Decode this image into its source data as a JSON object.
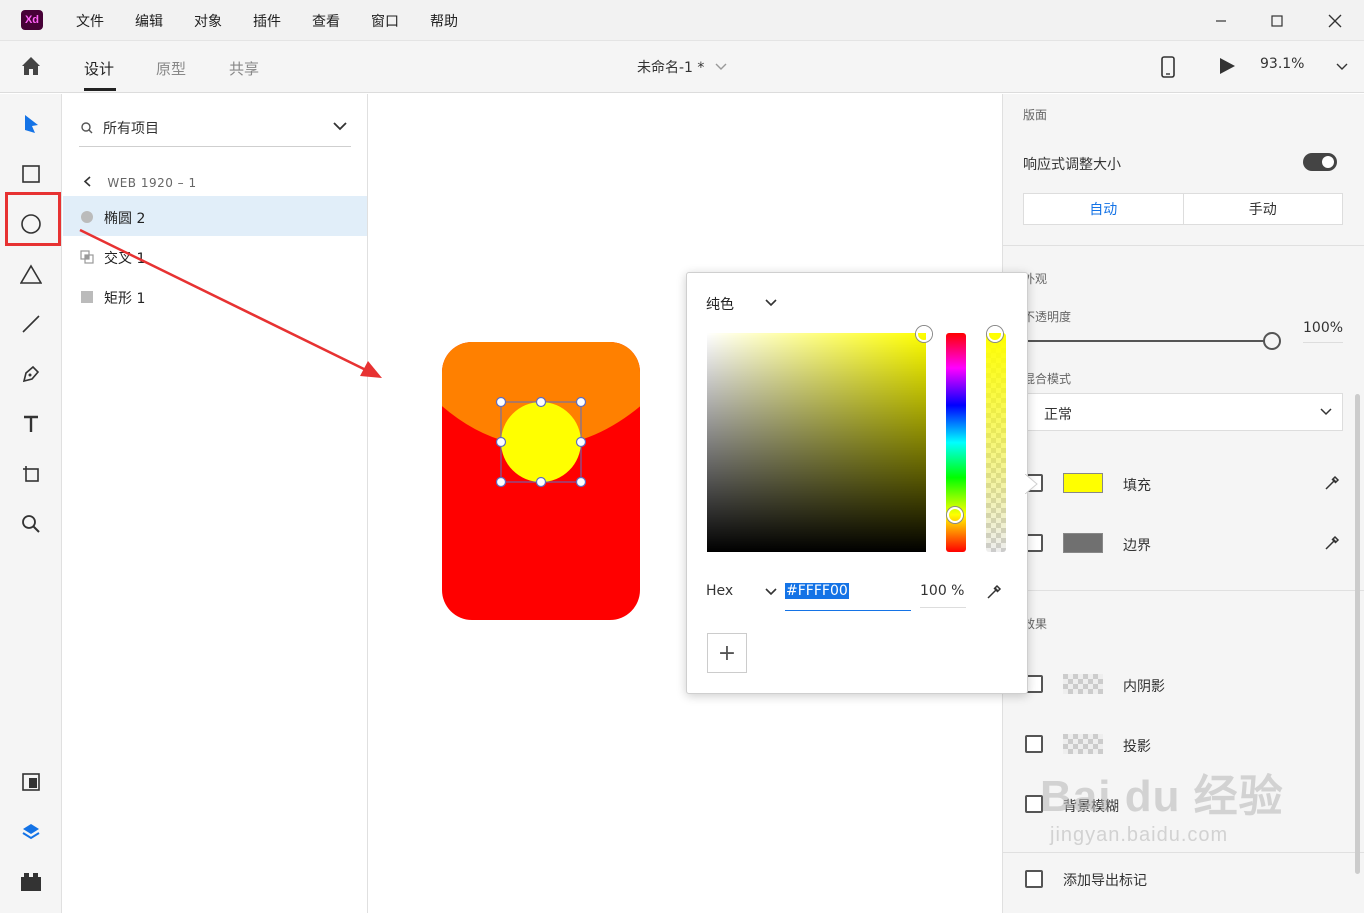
{
  "app": {
    "logo_text": "Xd",
    "menu": [
      "文件",
      "编辑",
      "对象",
      "插件",
      "查看",
      "窗口",
      "帮助"
    ]
  },
  "toolbar": {
    "tabs": [
      "设计",
      "原型",
      "共享"
    ],
    "active_tab": "设计",
    "doc_title": "未命名-1 *",
    "zoom": "93.1%"
  },
  "tools": [
    "select-tool",
    "rectangle-tool",
    "ellipse-tool",
    "polygon-tool",
    "line-tool",
    "pen-tool",
    "text-tool",
    "artboard-tool",
    "zoom-tool",
    "assets",
    "layers",
    "plugins"
  ],
  "layers": {
    "filter_label": "所有项目",
    "breadcrumb": "WEB 1920 – 1",
    "items": [
      {
        "label": "椭圆 2",
        "selected": true
      },
      {
        "label": "交叉 1",
        "selected": false
      },
      {
        "label": "矩形 1",
        "selected": false
      }
    ]
  },
  "color_picker": {
    "type_label": "纯色",
    "mode_label": "Hex",
    "hex_value": "#FFFF00",
    "alpha_value": "100 %",
    "add_label": "+"
  },
  "properties": {
    "layout_title": "版面",
    "responsive_label": "响应式调整大小",
    "responsive_on": true,
    "seg_auto": "自动",
    "seg_manual": "手动",
    "appearance_title": "外观",
    "opacity_label": "不透明度",
    "opacity_value": "100%",
    "blend_label": "混合模式",
    "blend_value": "正常",
    "fill_label": "填充",
    "fill_color": "#ffff00",
    "border_label": "边界",
    "border_color": "#707070",
    "effects_title": "效果",
    "inner_shadow_label": "内阴影",
    "drop_shadow_label": "投影",
    "bg_blur_label": "背景模糊",
    "export_label": "添加导出标记"
  },
  "canvas": {
    "card_top_color": "#ff8000",
    "card_bottom_color": "#ff0000",
    "ellipse_color": "#ffff00"
  },
  "watermark": {
    "brand": "Bai du 经验",
    "url": "jingyan.baidu.com"
  }
}
